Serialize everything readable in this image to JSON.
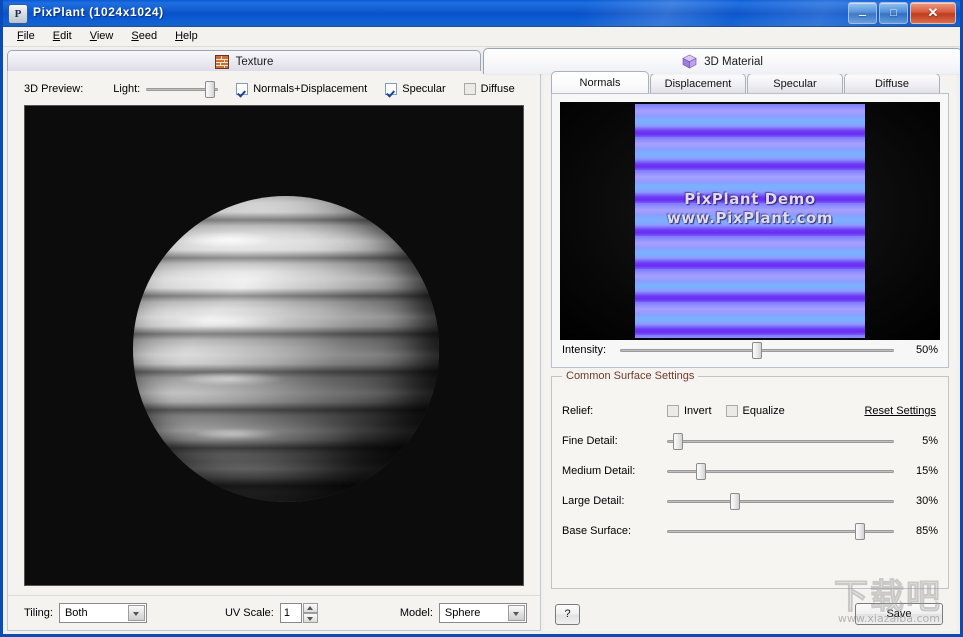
{
  "window": {
    "title": "PixPlant  (1024x1024)",
    "app_icon": "pixplant-logo-icon",
    "buttons": {
      "minimize": "–",
      "maximize": "□",
      "close": "✕"
    }
  },
  "menu": {
    "items": [
      {
        "label": "File",
        "accel": "F"
      },
      {
        "label": "Edit",
        "accel": "E"
      },
      {
        "label": "View",
        "accel": "V"
      },
      {
        "label": "Seed",
        "accel": "S"
      },
      {
        "label": "Help",
        "accel": "H"
      }
    ]
  },
  "main_tabs": [
    {
      "label": "Texture",
      "icon": "brick-wall-icon",
      "active": false
    },
    {
      "label": "3D Material",
      "icon": "cube-icon",
      "active": true
    }
  ],
  "preview": {
    "title": "3D Preview:",
    "light_label": "Light:",
    "light_value": 88,
    "checkboxes": [
      {
        "label": "Normals+Displacement",
        "checked": true,
        "enabled": true
      },
      {
        "label": "Specular",
        "checked": true,
        "enabled": true
      },
      {
        "label": "Diffuse",
        "checked": false,
        "enabled": false
      }
    ],
    "render": "striped-grayscale-sphere"
  },
  "bottom_left": {
    "tiling_label": "Tiling:",
    "tiling_value": "Both",
    "uv_scale_label": "UV Scale:",
    "uv_scale_value": "1",
    "model_label": "Model:",
    "model_value": "Sphere"
  },
  "map_tabs": [
    {
      "label": "Normals",
      "active": true
    },
    {
      "label": "Displacement",
      "active": false
    },
    {
      "label": "Specular",
      "active": false
    },
    {
      "label": "Diffuse",
      "active": false
    }
  ],
  "map_preview": {
    "watermark_line1": "PixPlant Demo",
    "watermark_line2": "www.PixPlant.com",
    "image_description": "normal-map-horizontal-stripes"
  },
  "intensity": {
    "label": "Intensity:",
    "value": 50,
    "value_text": "50%"
  },
  "surface_settings": {
    "legend": "Common Surface Settings",
    "relief_label": "Relief:",
    "relief_checkboxes": [
      {
        "label": "Invert",
        "checked": false
      },
      {
        "label": "Equalize",
        "checked": false
      }
    ],
    "reset_label": "Reset Settings",
    "sliders": [
      {
        "label": "Fine Detail:",
        "value": 5,
        "value_text": "5%"
      },
      {
        "label": "Medium Detail:",
        "value": 15,
        "value_text": "15%"
      },
      {
        "label": "Large Detail:",
        "value": 30,
        "value_text": "30%"
      },
      {
        "label": "Base Surface:",
        "value": 85,
        "value_text": "85%"
      }
    ]
  },
  "bottom_right": {
    "help_label": "?",
    "save_label": "Save"
  },
  "watermark": {
    "cn": "下载吧",
    "url": "www.xiazaiba.com"
  },
  "colors": {
    "title_bar": "#0a52c8",
    "close_button": "#c0392b",
    "legend_text": "#6d3b2e",
    "normal_map_blue": "#7b7bff",
    "normal_map_violet": "#6a2df2"
  }
}
